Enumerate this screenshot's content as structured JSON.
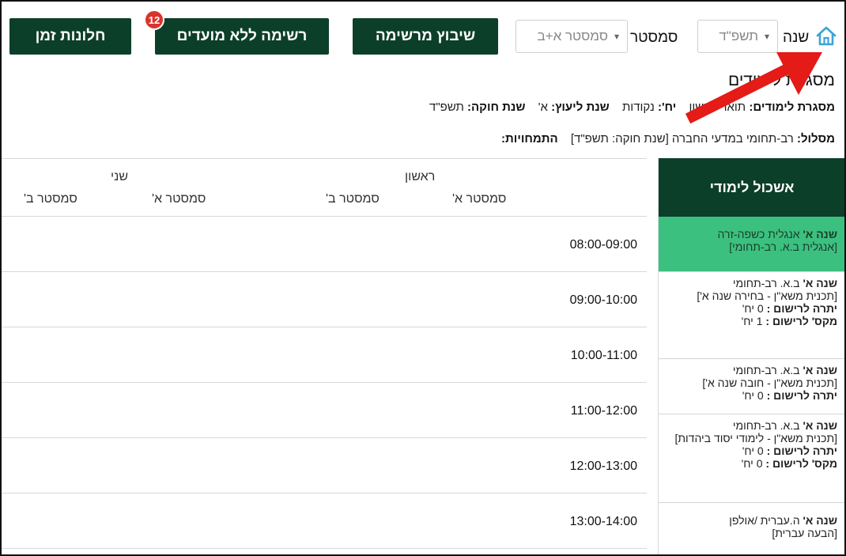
{
  "toolbar": {
    "home_icon": "home-icon",
    "year_label": "שנה",
    "year_value": "תשפ\"ד",
    "semester_label": "סמסטר",
    "semester_value": "סמסטר א+ב",
    "btn_assign": "שיבוץ מרשימה",
    "btn_unscheduled": "רשימה ללא מועדים",
    "unscheduled_count": "12",
    "btn_windows": "חלונות זמן"
  },
  "info": {
    "title": "מסגרת לימודים",
    "framework_label": "מסגרת לימודים:",
    "framework_value": "תואר ראשון",
    "credits_label": "יח':",
    "credits_value": "נקודות",
    "advisory_year_label": "שנת ליעוץ:",
    "advisory_year_value": "א'",
    "regulation_year_label": "שנת חוקה:",
    "regulation_year_value": "תשפ\"ד",
    "track_label": "מסלול:",
    "track_value": "רב-תחומי במדעי החברה [שנת חוקה: תשפ\"ד]",
    "specializations_label": "התמחויות:"
  },
  "panel": {
    "header": "אשכול לימודי",
    "tracks": [
      {
        "year": "שנה א'",
        "lines": [
          "אנגלית כשפה-זרה",
          "[אנגלית ב.א. רב-תחומי]"
        ],
        "remaining": "",
        "max": ""
      },
      {
        "year": "שנה א'",
        "lines": [
          "ב.א. רב-תחומי",
          "[תכנית משא\"ן - בחירה שנה א']"
        ],
        "remaining": "0 יח'",
        "max": "1 יח'"
      },
      {
        "year": "שנה א'",
        "lines": [
          "ב.א. רב-תחומי",
          "[תכנית משא\"ן - חובה שנה א']"
        ],
        "remaining": "0 יח'",
        "max": ""
      },
      {
        "year": "שנה א'",
        "lines": [
          "ב.א. רב-תחומי",
          "[תכנית משא\"ן - לימודי יסוד ביהדות]"
        ],
        "remaining": "0 יח'",
        "max": "0 יח'"
      },
      {
        "year": "שנה א'",
        "lines": [
          "ה.עברית /אולפן",
          "[הבעה עברית]"
        ],
        "remaining": "",
        "max": ""
      }
    ],
    "remaining_label": "יתרה לרישום :",
    "max_label": "מקס' לרישום :"
  },
  "grid": {
    "days": [
      "ראשון",
      "שני"
    ],
    "semesters": [
      "סמסטר א'",
      "סמסטר ב'",
      "סמסטר א'",
      "סמסטר ב'"
    ],
    "times": [
      "08:00-09:00",
      "09:00-10:00",
      "10:00-11:00",
      "11:00-12:00",
      "12:00-13:00",
      "13:00-14:00"
    ]
  }
}
